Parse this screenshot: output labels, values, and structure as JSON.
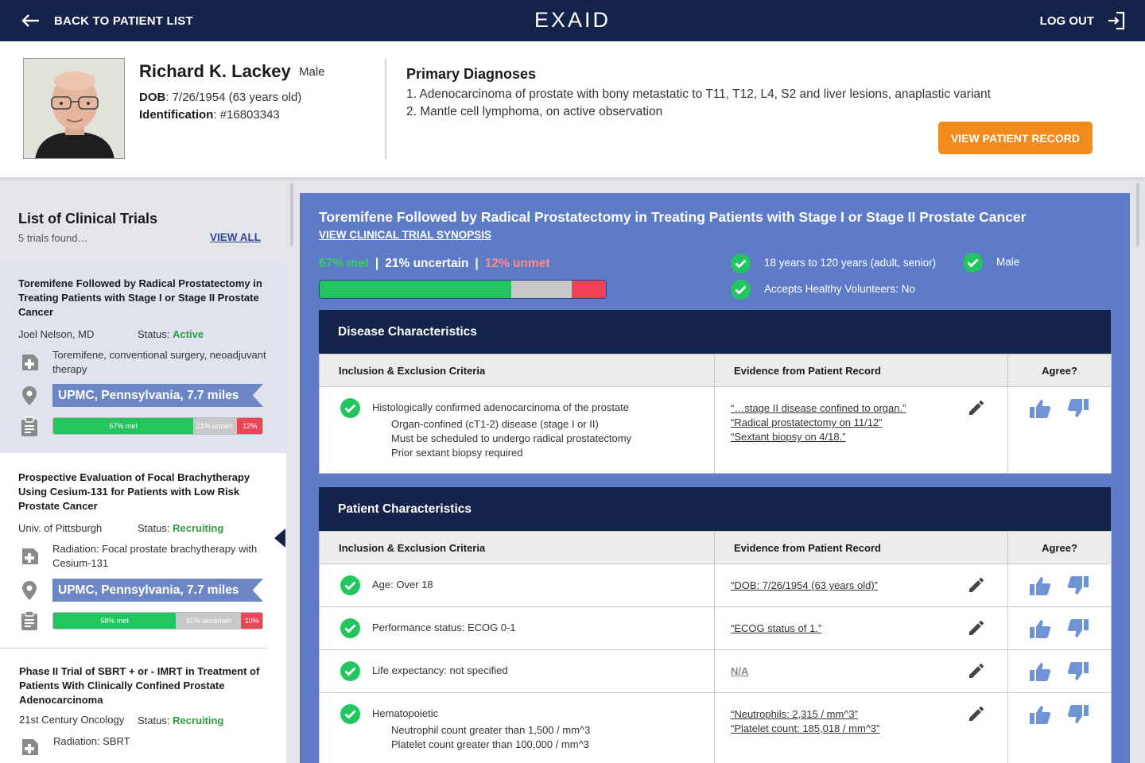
{
  "topbar": {
    "back_label": "BACK TO PATIENT LIST",
    "brand": "EXAID",
    "logout_label": "LOG OUT"
  },
  "patient": {
    "name": "Richard K. Lackey",
    "sex": "Male",
    "dob_label": "DOB",
    "dob_value": ": 7/26/1954 (63 years old)",
    "id_label": "Identification",
    "id_value": ": #16803343",
    "diagnoses_title": "Primary Diagnoses",
    "diagnoses": [
      "1. Adenocarcinoma of prostate with bony metastatic to T11, T12, L4, S2 and liver lesions, anaplastic variant",
      "2. Mantle cell lymphoma, on active observation"
    ],
    "view_record_label": "VIEW PATIENT RECORD"
  },
  "sidebar": {
    "title": "List of Clinical Trials",
    "count": "5 trials found…",
    "view_all": "VIEW ALL",
    "status_label": "Status:",
    "trials": [
      {
        "title": "Toremifene Followed by Radical Prostatectomy in Treating Patients with Stage I or Stage II Prostate Cancer",
        "institution": "Joel Nelson, MD",
        "status": "Active",
        "intervention": "Toremifene, conventional surgery, neoadjuvant therapy",
        "location": "UPMC, Pennsylvania, 7.7 miles",
        "met_label": "67% met",
        "uncertain_label": "21% uncert.",
        "unmet_label": "12%",
        "met": 67,
        "uncertain": 21,
        "unmet": 12
      },
      {
        "title": "Prospective Evaluation of Focal Brachytherapy Using Cesium-131 for Patients with Low Risk Prostate Cancer",
        "institution": "Univ. of Pittsburgh",
        "status": "Recruiting",
        "intervention": "Radiation: Focal prostate brachytherapy with Cesium-131",
        "location": "UPMC, Pennsylvania, 7.7 miles",
        "met_label": "58% met",
        "uncertain_label": "31% uncertain",
        "unmet_label": "10%",
        "met": 58,
        "uncertain": 31,
        "unmet": 10
      },
      {
        "title": "Phase II Trial of SBRT + or - IMRT in Treatment of Patients With Clinically Confined Prostate Adenocarcinoma",
        "institution": "21st Century Oncology",
        "status": "Recruiting",
        "intervention": "Radiation: SBRT"
      }
    ]
  },
  "main": {
    "title": "Toremifene Followed by Radical Prostatectomy in Treating Patients with Stage I or Stage II Prostate Cancer",
    "synopsis_link": "VIEW CLINICAL TRIAL SYNOPSIS",
    "met_label": "67% met",
    "uncertain_label": "21% uncertain",
    "unmet_label": "12% unmet",
    "separator": "|",
    "met": 67,
    "uncertain": 21,
    "unmet": 12,
    "eligibility": {
      "age": "18 years to 120 years (adult, senior)",
      "sex": "Male",
      "volunteers": "Accepts Healthy Volunteers: No"
    },
    "table_headers": {
      "criteria": "Inclusion & Exclusion Criteria",
      "evidence": "Evidence from Patient Record",
      "agree": "Agree?"
    },
    "disease": {
      "title": "Disease Characteristics",
      "rows": [
        {
          "criterion": "Histologically confirmed adenocarcinoma of the prostate",
          "sub": [
            "Organ-confined (cT1-2) disease (stage I or II)",
            "Must be scheduled to undergo radical prostatectomy",
            "Prior sextant biopsy required"
          ],
          "evidence": [
            "“…stage II disease confined to organ.”",
            "“Radical prostatectomy on 11/12”",
            "“Sextant biopsy on 4/18.”"
          ]
        }
      ]
    },
    "patient_chars": {
      "title": "Patient Characteristics",
      "rows": [
        {
          "criterion": "Age: Over 18",
          "evidence": [
            "“DOB: 7/26/1954 (63 years old)”"
          ]
        },
        {
          "criterion": "Performance status: ECOG 0-1",
          "evidence": [
            "“ECOG status of 1.”"
          ]
        },
        {
          "criterion": "Life expectancy: not specified",
          "evidence_na": "N/A"
        },
        {
          "criterion": "Hematopoietic",
          "sub": [
            "Neutrophil count greater than 1,500 / mm^3",
            "Platelet count greater than 100,000 / mm^3"
          ],
          "evidence": [
            "“Neutrophils: 2,315 / mm^3”",
            "“Platelet count: 185,018 / mm^3”"
          ]
        }
      ]
    }
  },
  "colors": {
    "navy": "#13234a",
    "panel": "#5d7bc6",
    "orange": "#f28a1c",
    "met": "#22c55e",
    "uncertain": "#c8c8c8",
    "unmet": "#ef4458",
    "thumb": "#6f94d6"
  }
}
